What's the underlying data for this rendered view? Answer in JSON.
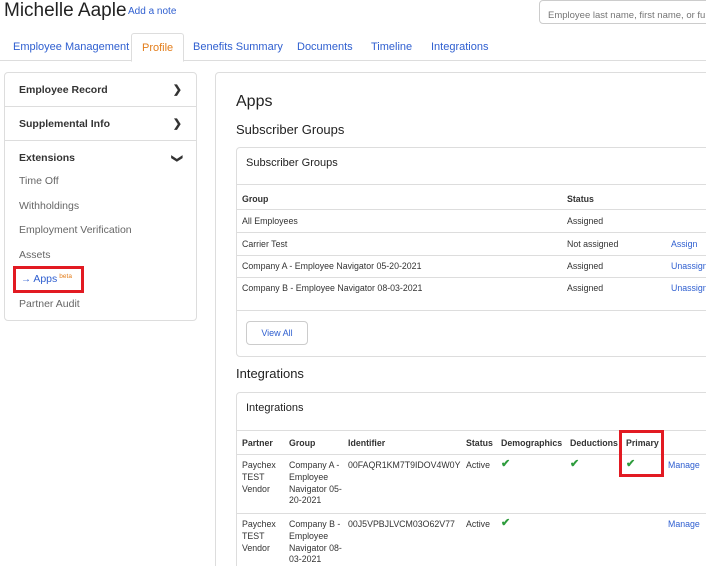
{
  "header": {
    "employee_name": "Michelle Aaple",
    "add_note": "Add a note",
    "search_placeholder": "Employee last name, first name, or full SSN"
  },
  "tabs": [
    {
      "label": "Employee Management"
    },
    {
      "label": "Profile"
    },
    {
      "label": "Benefits Summary"
    },
    {
      "label": "Documents"
    },
    {
      "label": "Timeline"
    },
    {
      "label": "Integrations"
    }
  ],
  "sidebar": {
    "employee_record": "Employee Record",
    "supplemental_info": "Supplemental Info",
    "extensions": "Extensions",
    "items": [
      "Time Off",
      "Withholdings",
      "Employment Verification",
      "Assets"
    ],
    "apps_label": "Apps",
    "apps_badge": "beta",
    "partner_audit": "Partner Audit"
  },
  "main": {
    "page_title": "Apps",
    "subscriber_heading": "Subscriber Groups",
    "subscriber_card": {
      "title": "Subscriber Groups",
      "columns": [
        "Group",
        "Status"
      ],
      "rows": [
        {
          "group": "All Employees",
          "status": "Assigned",
          "action": ""
        },
        {
          "group": "Carrier Test",
          "status": "Not assigned",
          "action": "Assign"
        },
        {
          "group": "Company A - Employee Navigator 05-20-2021",
          "status": "Assigned",
          "action": "Unassign"
        },
        {
          "group": "Company B - Employee Navigator 08-03-2021",
          "status": "Assigned",
          "action": "Unassign"
        }
      ],
      "view_all": "View All"
    },
    "integrations_heading": "Integrations",
    "integrations_card": {
      "title": "Integrations",
      "columns": [
        "Partner",
        "Group",
        "Identifier",
        "Status",
        "Demographics",
        "Deductions",
        "Primary"
      ],
      "rows": [
        {
          "partner": "Paychex TEST Vendor",
          "group": "Company A - Employee Navigator 05-20-2021",
          "identifier": "00FAQR1KM7T9IDOV4W0Y",
          "status": "Active",
          "action": "Manage"
        },
        {
          "partner": "Paychex TEST Vendor",
          "group": "Company B - Employee Navigator 08-03-2021",
          "identifier": "00J5VPBJLVCM03O62V77",
          "status": "Active",
          "action": "Manage"
        }
      ]
    }
  },
  "colors": {
    "link": "#2f5fd0",
    "active_tab": "#e37d1a",
    "check": "#2e9c3d",
    "highlight": "#e21a22"
  },
  "icons": {
    "chevron_right": "chevron-right-icon",
    "chevron_down": "chevron-down-icon",
    "arrow_right": "arrow-right-icon",
    "check": "check-icon"
  }
}
